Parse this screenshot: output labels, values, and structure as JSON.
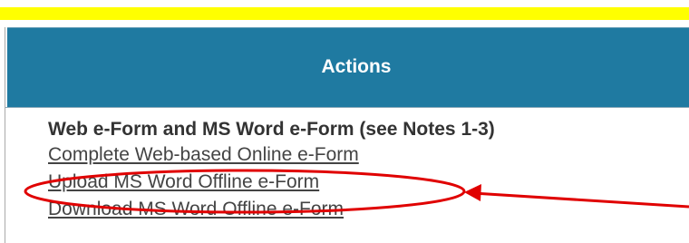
{
  "table": {
    "header": {
      "title": "Actions"
    },
    "cell": {
      "heading": "Web e-Form and MS Word e-Form (see Notes 1-3)",
      "links": [
        {
          "label": "Complete Web-based Online e-Form"
        },
        {
          "label": "Upload MS Word Offline e-Form"
        },
        {
          "label": "Download MS Word Offline e-Form"
        }
      ]
    }
  },
  "colors": {
    "highlight_bar": "#ffff00",
    "header_bg": "#1f7aa1",
    "annotation": "#e00000"
  }
}
